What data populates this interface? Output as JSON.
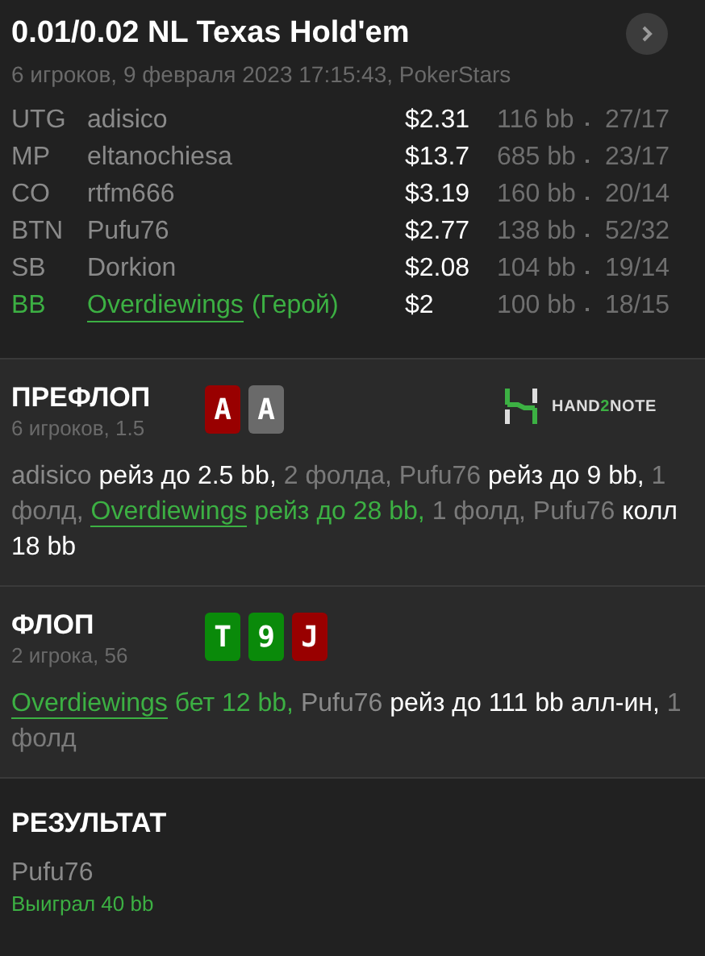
{
  "header": {
    "title": "0.01/0.02 NL Texas Hold'em",
    "subtitle": "6 игроков, 9 февраля 2023 17:15:43, PokerStars"
  },
  "players": [
    {
      "position": "UTG",
      "name": "adisico",
      "hero": false,
      "stack": "$2.31",
      "bb": "116 bb",
      "stats": "27/17"
    },
    {
      "position": "MP",
      "name": "eltanochiesa",
      "hero": false,
      "stack": "$13.7",
      "bb": "685 bb",
      "stats": "23/17"
    },
    {
      "position": "CO",
      "name": "rtfm666",
      "hero": false,
      "stack": "$3.19",
      "bb": "160 bb",
      "stats": "20/14"
    },
    {
      "position": "BTN",
      "name": "Pufu76",
      "hero": false,
      "stack": "$2.77",
      "bb": "138 bb",
      "stats": "52/32"
    },
    {
      "position": "SB",
      "name": "Dorkion",
      "hero": false,
      "stack": "$2.08",
      "bb": "104 bb",
      "stats": "19/14"
    },
    {
      "position": "BB",
      "name": "Overdiewings",
      "hero": true,
      "hero_label": "(Герой)",
      "stack": "$2",
      "bb": "100 bb",
      "stats": "18/15"
    }
  ],
  "streets": [
    {
      "title": "ПРЕФЛОП",
      "info": "6 игроков, 1.5",
      "cards": [
        {
          "rank": "A",
          "color": "#990000"
        },
        {
          "rank": "A",
          "color": "#6a6a6a"
        }
      ],
      "logo": {
        "prefix": "HAND",
        "mark": "2",
        "suffix": "NOTE"
      },
      "actions": [
        {
          "text": "adisico",
          "kind": "name",
          "hero": false
        },
        {
          "text": "рейз до 2.5 bb,",
          "kind": "action",
          "hero": false
        },
        {
          "text": "2 фолда, Pufu76",
          "kind": "info",
          "hero": false
        },
        {
          "text": "рейз до 9 bb,",
          "kind": "action",
          "hero": false
        },
        {
          "text": "1 фолд,",
          "kind": "info",
          "hero": false
        },
        {
          "text": "Overdiewings",
          "kind": "name",
          "hero": true
        },
        {
          "text": "рейз до 28 bb,",
          "kind": "action",
          "hero": true
        },
        {
          "text": "1 фолд, Pufu76",
          "kind": "info",
          "hero": false
        },
        {
          "text": "колл 18 bb",
          "kind": "action",
          "hero": false
        }
      ]
    },
    {
      "title": "ФЛОП",
      "info": "2 игрока, 56",
      "cards": [
        {
          "rank": "T",
          "color": "#0a8a0a"
        },
        {
          "rank": "9",
          "color": "#0a8a0a"
        },
        {
          "rank": "J",
          "color": "#990000"
        }
      ],
      "actions": [
        {
          "text": "Overdiewings",
          "kind": "name",
          "hero": true
        },
        {
          "text": "бет 12 bb,",
          "kind": "action",
          "hero": true
        },
        {
          "text": "Pufu76",
          "kind": "name",
          "hero": false
        },
        {
          "text": "рейз до 111 bb алл-ин,",
          "kind": "action",
          "hero": false
        },
        {
          "text": "1 фолд",
          "kind": "info",
          "hero": false
        }
      ]
    }
  ],
  "result": {
    "title": "РЕЗУЛЬТАТ",
    "winner": "Pufu76",
    "outcome": "Выиграл 40 bb"
  }
}
